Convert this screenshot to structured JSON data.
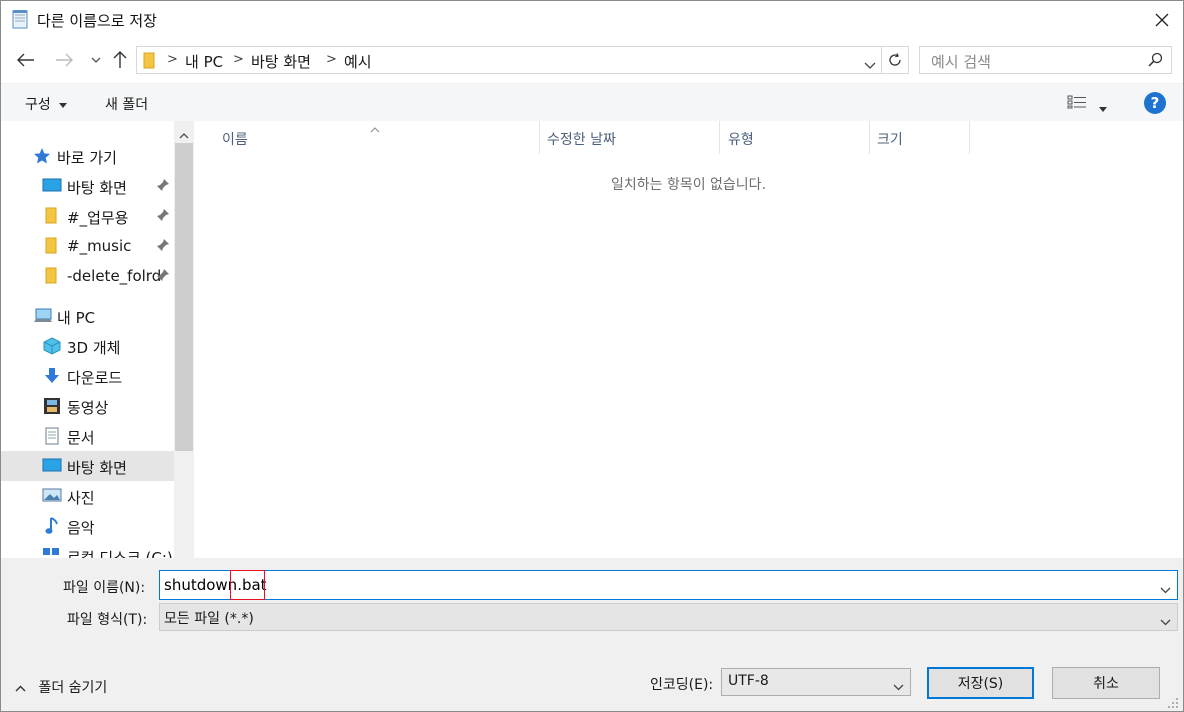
{
  "window": {
    "title": "다른 이름으로 저장"
  },
  "address": {
    "segments": [
      "내 PC",
      "바탕 화면",
      "예시"
    ],
    "search_placeholder": "예시 검색"
  },
  "toolbar": {
    "organize": "구성",
    "new_folder": "새 폴더",
    "help": "?"
  },
  "sidebar": {
    "quick_access": "바로 가기",
    "quick_items": [
      "바탕 화면",
      "#_업무용",
      "#_music",
      "-delete_folrd"
    ],
    "this_pc": "내 PC",
    "pc_items": [
      "3D 개체",
      "다운로드",
      "동영상",
      "문서",
      "바탕 화면",
      "사진",
      "음악",
      "로컬 디스크 (C:)"
    ],
    "selected": "바탕 화면"
  },
  "filelist": {
    "columns": [
      "이름",
      "수정한 날짜",
      "유형",
      "크기"
    ],
    "empty_message": "일치하는 항목이 없습니다."
  },
  "form": {
    "filename_label": "파일 이름(N):",
    "filename_prefix": "shutdown",
    "filename_ext": ".bat",
    "filetype_label": "파일 형식(T):",
    "filetype_value": "모든 파일 (*.*)",
    "encoding_label": "인코딩(E):",
    "encoding_value": "UTF-8",
    "save": "저장(S)",
    "cancel": "취소",
    "hide_folders": "폴더 숨기기"
  },
  "colors": {
    "accent": "#0078d7",
    "highlight_box": "#e81123",
    "help_blue": "#1f73d0",
    "folder_yellow": "#f4c542"
  }
}
